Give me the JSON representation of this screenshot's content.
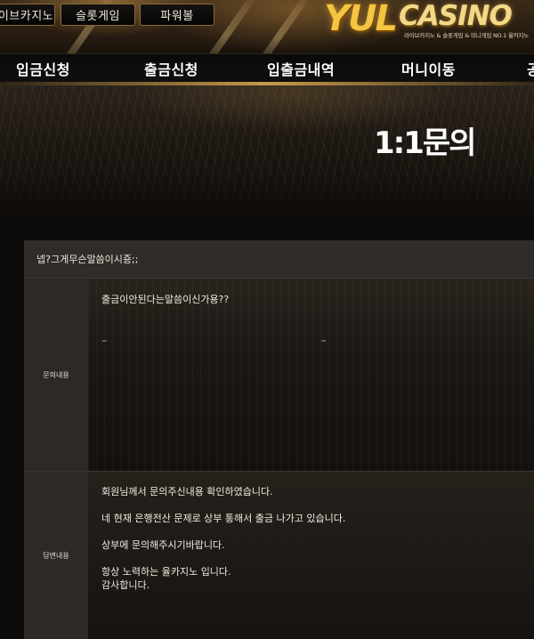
{
  "top_buttons": {
    "live_casino": "이브카지노",
    "slot_game": "슬롯게임",
    "powerball": "파워볼"
  },
  "logo": {
    "word1": "YUL",
    "word2": "CASINO",
    "tagline": "라이브카지노 & 슬롯게임 & 미니게임 NO.1 율카지노"
  },
  "nav": {
    "deposit": "입금신청",
    "withdraw": "출금신청",
    "history": "입출금내역",
    "transfer": "머니이동",
    "more": "공"
  },
  "page_title": "1:1문의",
  "inquiry": {
    "subject": "넵?그게무슨말씀이시죵;;",
    "content_label": "문의내용",
    "content": "출금이안된다는말씀이신가용??",
    "answer_label": "답변내용",
    "answer_lines": [
      "회원님께서 문의주신내용 확인하였습니다.",
      "",
      "네 현재 은행전산 문제로 상부 통해서 출금 나가고 있습니다.",
      "",
      "상부에 문의해주시기바랍니다.",
      "",
      "항상 노력하는 율카지노 입니다.",
      "감사합니다."
    ]
  },
  "colors": {
    "accent_gold": "#f5c440",
    "panel_bg": "#1a1816",
    "label_bg": "#2c2927"
  }
}
